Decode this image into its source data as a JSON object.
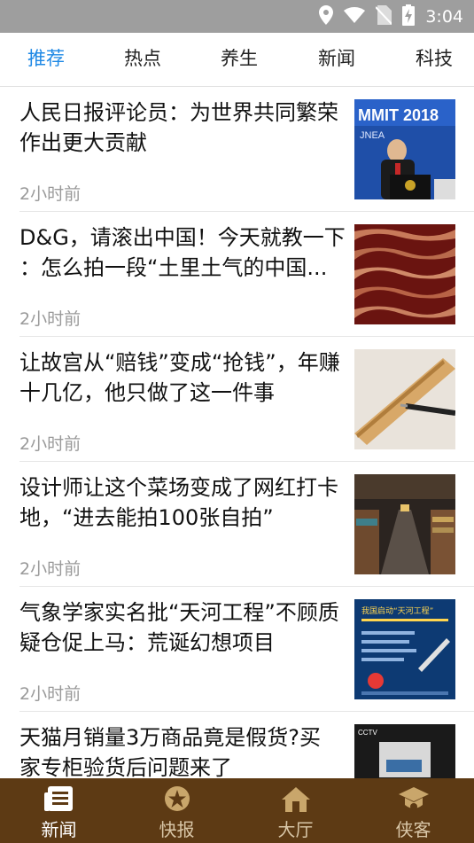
{
  "status_bar": {
    "time": "3:04"
  },
  "tabs": [
    {
      "label": "推荐",
      "active": true
    },
    {
      "label": "热点"
    },
    {
      "label": "养生"
    },
    {
      "label": "新闻"
    },
    {
      "label": "科技"
    }
  ],
  "feed": [
    {
      "line1": "人民日报评论员：为世界共同繁荣",
      "line2": "作出更大贡献",
      "time": "2小时前",
      "thumb_text": "MMIT 2018",
      "thumb_sub": "JNEA"
    },
    {
      "line1": "D&G，请滚出中国！今天就教一下",
      "line2": "：怎么拍一段“土里土气的中国...",
      "time": "2小时前"
    },
    {
      "line1": "让故宫从“赔钱”变成“抢钱”，年赚",
      "line2": "十几亿，他只做了这一件事",
      "time": "2小时前"
    },
    {
      "line1": "设计师让这个菜场变成了网红打卡",
      "line2": "地，“进去能拍100张自拍”",
      "time": "2小时前"
    },
    {
      "line1": "气象学家实名批“天河工程”不顾质",
      "line2": "疑仓促上马：荒诞幻想项目",
      "time": "2小时前",
      "thumb_text": "我国启动“天河工程”"
    },
    {
      "line1": "天猫月销量3万商品竟是假货?买",
      "line2": "家专柜验货后问题来了",
      "time": "",
      "thumb_text": "CCTV"
    }
  ],
  "bottom_nav": [
    {
      "label": "新闻",
      "icon": "newspaper-icon",
      "active": true
    },
    {
      "label": "快报",
      "icon": "star-coin-icon"
    },
    {
      "label": "大厅",
      "icon": "home-icon"
    },
    {
      "label": "侠客",
      "icon": "graduate-icon"
    }
  ],
  "colors": {
    "tab_active": "#1e88e5",
    "bottom_nav_bg": "#5d3a14",
    "status_bar": "#9e9e9e"
  }
}
